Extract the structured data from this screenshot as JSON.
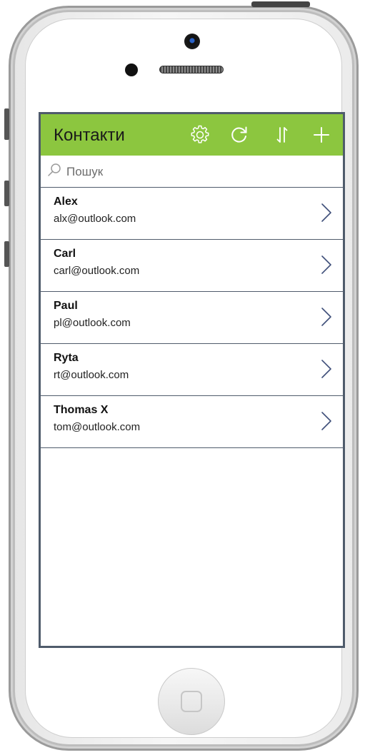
{
  "app": {
    "title": "Контакти",
    "accent_color": "#8cc63f",
    "border_color": "#4f5b6b"
  },
  "toolbar": {
    "icons": [
      "gear-icon",
      "refresh-icon",
      "sort-icon",
      "plus-icon"
    ]
  },
  "search": {
    "placeholder": "Пошук",
    "value": ""
  },
  "contacts": [
    {
      "name": "Alex",
      "email": "alx@outlook.com"
    },
    {
      "name": "Carl",
      "email": "carl@outlook.com"
    },
    {
      "name": "Paul",
      "email": "pl@outlook.com"
    },
    {
      "name": "Ryta",
      "email": "rt@outlook.com"
    },
    {
      "name": "Thomas X",
      "email": "tom@outlook.com"
    }
  ]
}
